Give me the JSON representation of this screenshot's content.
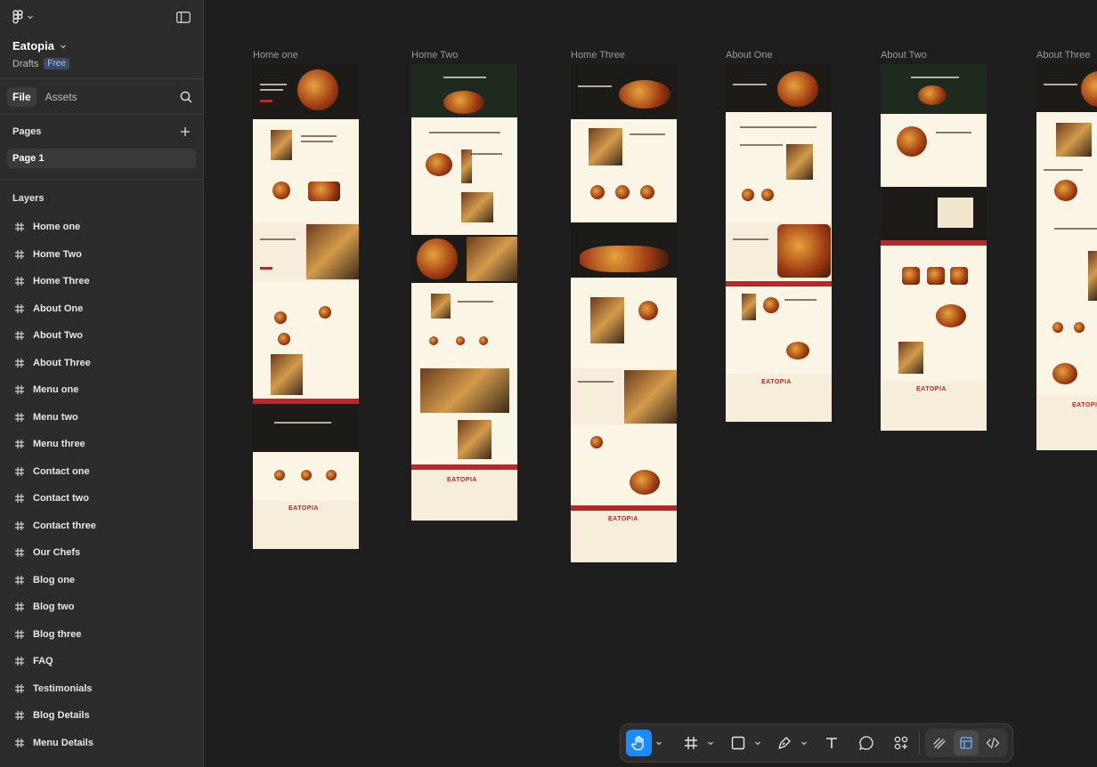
{
  "sidebar": {
    "file_name": "Eatopia",
    "location": "Drafts",
    "plan_badge": "Free",
    "tabs": [
      {
        "label": "File",
        "active": true
      },
      {
        "label": "Assets",
        "active": false
      }
    ],
    "pages_heading": "Pages",
    "pages": [
      "Page 1"
    ],
    "layers_heading": "Layers",
    "layers": [
      "Home one",
      "Home Two",
      "Home Three",
      "About One",
      "About Two",
      "About Three",
      "Menu one",
      "Menu two",
      "Menu three",
      "Contact one",
      "Contact two",
      "Contact three",
      "Our Chefs",
      "Blog one",
      "Blog two",
      "Blog three",
      "FAQ",
      "Testimonials",
      "Blog Details",
      "Menu Details"
    ]
  },
  "canvas": {
    "frames": [
      {
        "label": "Home one"
      },
      {
        "label": "Home Two"
      },
      {
        "label": "Home Three"
      },
      {
        "label": "About One"
      },
      {
        "label": "About Two"
      },
      {
        "label": "About Three"
      }
    ],
    "brand_mark": "EATOPIA"
  },
  "toolbar": {
    "tools": [
      "hand-tool",
      "frame-tool",
      "rectangle-tool",
      "pen-tool",
      "text-tool",
      "comment-tool",
      "actions-tool"
    ],
    "active_tool": "hand-tool",
    "modes": [
      "draw-mode",
      "design-mode",
      "dev-mode"
    ],
    "active_mode": "design-mode"
  },
  "colors": {
    "accent": "#1a8cff",
    "brand_red": "#b32a2a",
    "cream": "#fbf5e6"
  }
}
